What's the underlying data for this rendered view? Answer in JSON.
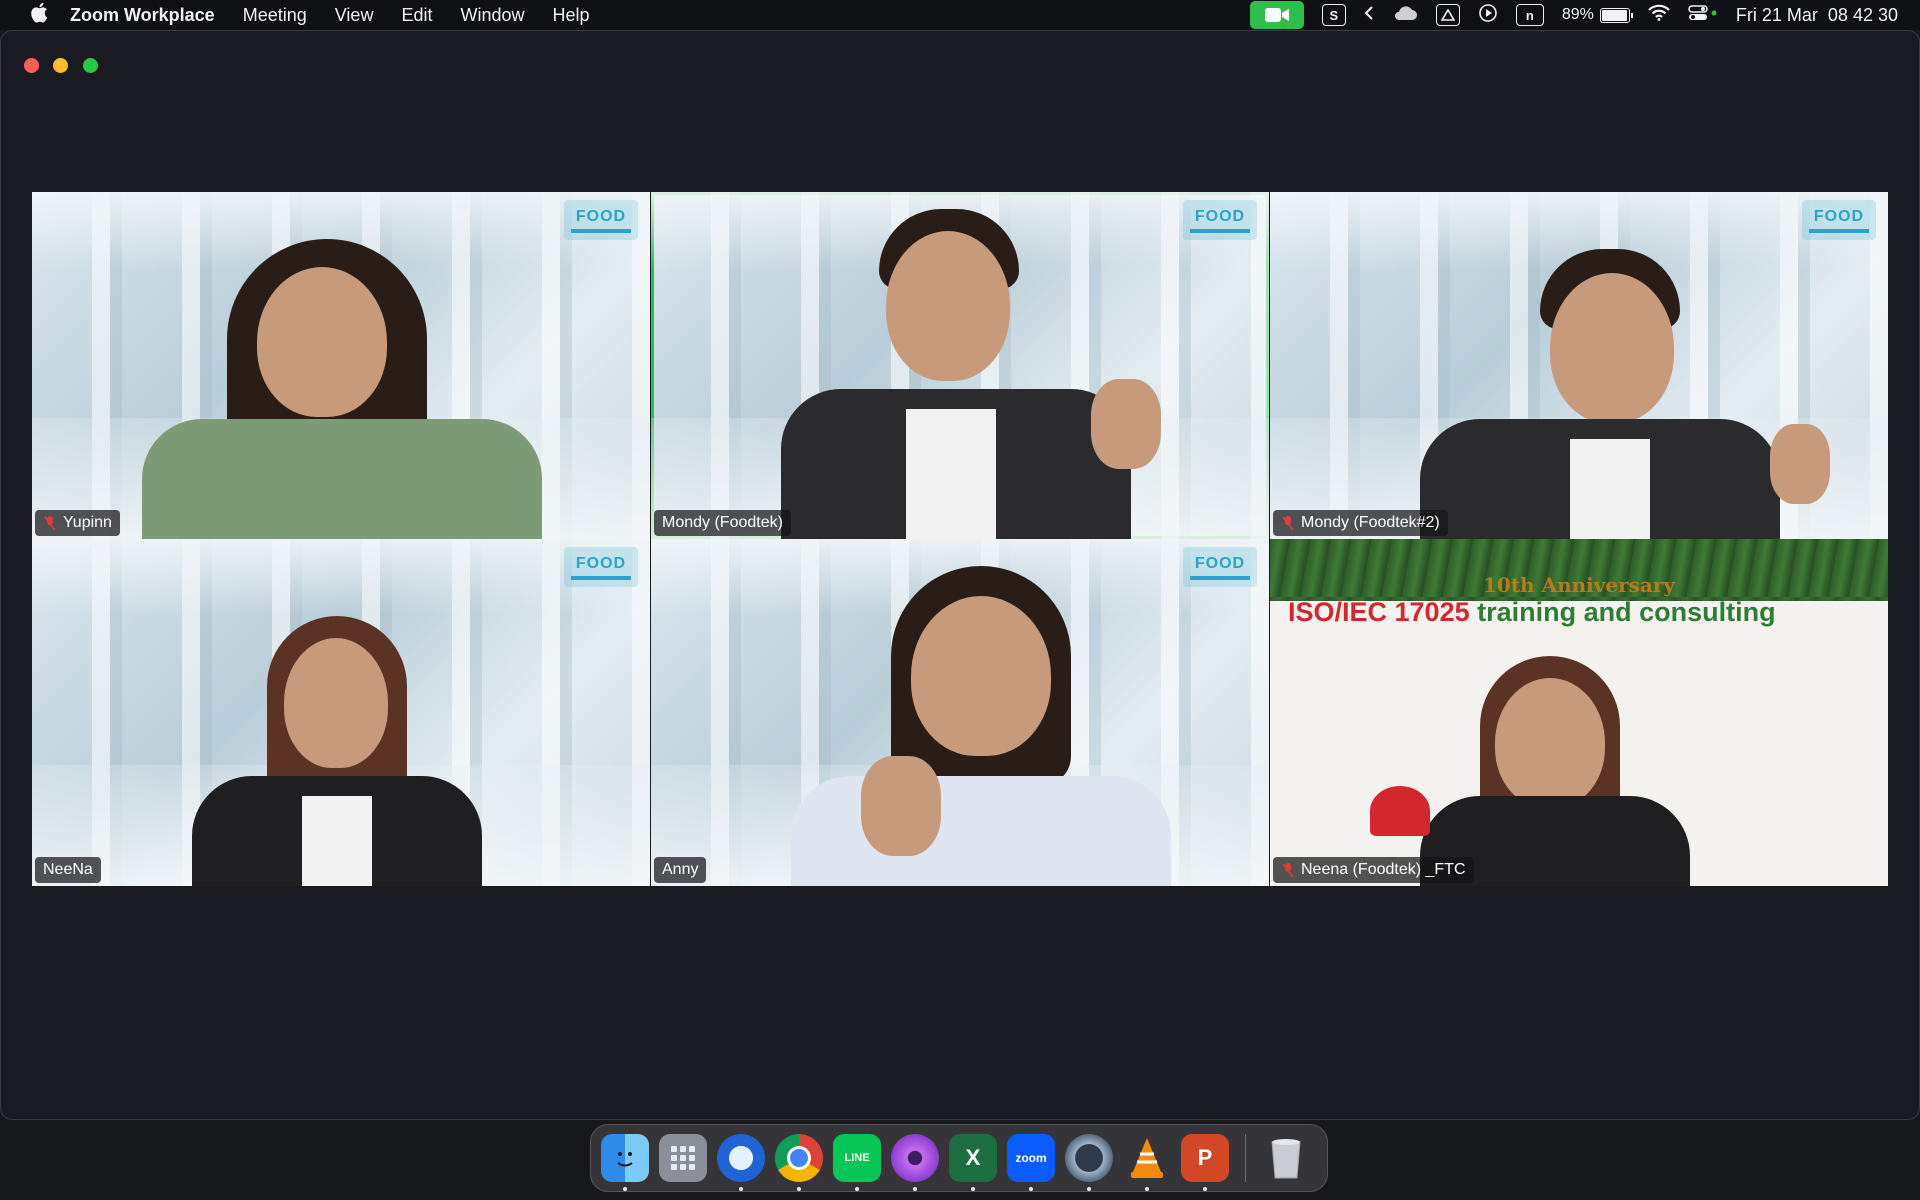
{
  "menubar": {
    "app_name": "Zoom Workplace",
    "menus": [
      "Meeting",
      "View",
      "Edit",
      "Window",
      "Help"
    ],
    "battery_percent": "89%",
    "battery_level": 0.89,
    "notion_glyph": "n",
    "skype_glyph": "S",
    "date": "Fri 21 Mar",
    "time": "08 42 30",
    "zoom_status_color": "#2fbe4a"
  },
  "participants": [
    {
      "name": "Yupinn",
      "muted": true
    },
    {
      "name": "Mondy (Foodtek)",
      "muted": false,
      "active_speaker": true
    },
    {
      "name": "Mondy (Foodtek#2)",
      "muted": true
    },
    {
      "name": "NeeNa",
      "muted": false
    },
    {
      "name": "Anny",
      "muted": false
    },
    {
      "name": "Neena (Foodtek) _FTC",
      "muted": true
    }
  ],
  "background_logo": {
    "text": "FOOD"
  },
  "banner": {
    "anniversary": "10th Anniversary",
    "title_part1": "ISO/IEC 17025",
    "title_part2": " training and consulting"
  },
  "dock": {
    "apps": [
      "Finder",
      "Launchpad",
      "Thunderbird",
      "Chrome",
      "LINE",
      "Flower",
      "Excel",
      "Zoom",
      "QuickTime",
      "VLC",
      "PowerPoint",
      "Trash"
    ],
    "zoom_label": "zoom",
    "line_label": "LINE",
    "excel_label": "X",
    "powerpoint_label": "P"
  }
}
